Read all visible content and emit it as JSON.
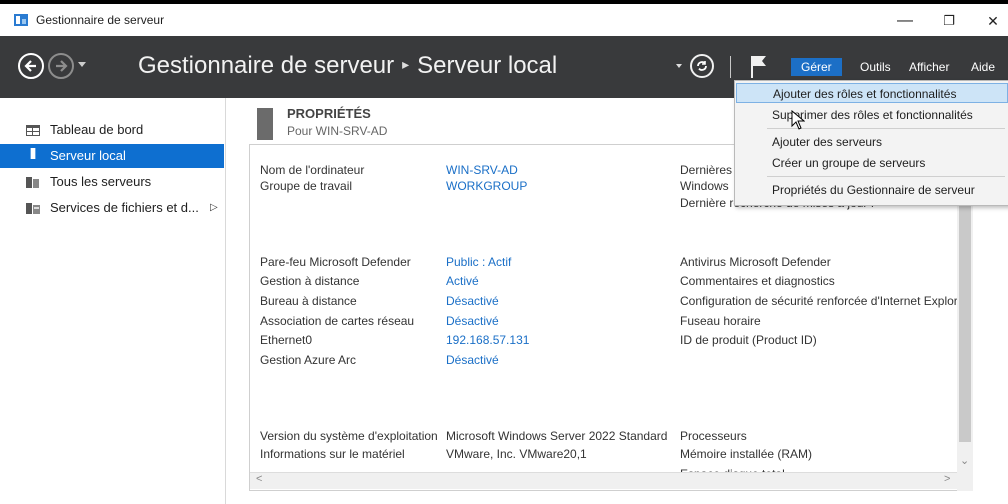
{
  "window": {
    "title": "Gestionnaire de serveur",
    "minimize": "—",
    "restore": "❐",
    "close": "✕"
  },
  "header": {
    "breadcrumb_root": "Gestionnaire de serveur",
    "breadcrumb_sep": "▸",
    "breadcrumb_current": "Serveur local",
    "menus": [
      "Gérer",
      "Outils",
      "Afficher",
      "Aide"
    ],
    "active_menu": "Gérer",
    "colors": {
      "bg": "#393a3c",
      "accent": "#1c6fc6"
    }
  },
  "sidebar": {
    "items": [
      {
        "label": "Tableau de bord",
        "icon": "dashboard-icon"
      },
      {
        "label": "Serveur local",
        "icon": "server-icon",
        "selected": true
      },
      {
        "label": "Tous les serveurs",
        "icon": "servers-icon"
      },
      {
        "label": "Services de fichiers et d...",
        "icon": "file-services-icon",
        "arrow": "▷"
      }
    ]
  },
  "properties": {
    "title": "PROPRIÉTÉS",
    "subtitle": "Pour WIN-SRV-AD",
    "left": [
      {
        "key": "Nom de l'ordinateur",
        "value": "WIN-SRV-AD",
        "link": true
      },
      {
        "key": "Groupe de travail",
        "value": "WORKGROUP",
        "link": true
      },
      {
        "key": "Pare-feu Microsoft Defender",
        "value": "Public : Actif",
        "link": true
      },
      {
        "key": "Gestion à distance",
        "value": "Activé",
        "link": true
      },
      {
        "key": "Bureau à distance",
        "value": "Désactivé",
        "link": true
      },
      {
        "key": "Association de cartes réseau",
        "value": "Désactivé",
        "link": true
      },
      {
        "key": "Ethernet0",
        "value": "192.168.57.131",
        "link": true
      },
      {
        "key": "Gestion Azure Arc",
        "value": "Désactivé",
        "link": true
      },
      {
        "key": "Version du système d'exploitation",
        "value": "Microsoft Windows Server 2022 Standard",
        "link": false
      },
      {
        "key": "Informations sur le matériel",
        "value": "VMware, Inc. VMware20,1",
        "link": false
      }
    ],
    "right": [
      "Dernières",
      "Windows",
      "Dernière recherche de mises à jour :",
      "Antivirus Microsoft Defender",
      "Commentaires et diagnostics",
      "Configuration de sécurité renforcée d'Internet Explore",
      "Fuseau horaire",
      "ID de produit (Product ID)",
      "Processeurs",
      "Mémoire installée (RAM)",
      "Espace disque total"
    ]
  },
  "dropdown": {
    "items": [
      "Ajouter des rôles et fonctionnalités",
      "Supprimer des rôles et fonctionnalités",
      "Ajouter des serveurs",
      "Créer un groupe de serveurs",
      "Propriétés du Gestionnaire de serveur"
    ],
    "highlighted": 0
  },
  "scroll": {
    "left_arrow": "<",
    "right_arrow": ">",
    "down_arrow": "⌄"
  }
}
